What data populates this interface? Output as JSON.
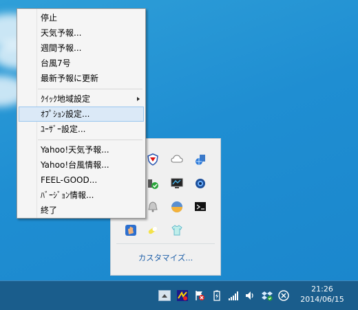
{
  "menu": {
    "items": [
      {
        "label": "停止"
      },
      {
        "label": "天気予報..."
      },
      {
        "label": "週間予報..."
      },
      {
        "label": "台風7号"
      },
      {
        "label": "最新予報に更新"
      },
      {
        "label": "ｸｲｯｸ地域設定"
      },
      {
        "label": "ｵﾌﾟｼｮﾝ設定..."
      },
      {
        "label": "ﾕｰｻﾞｰ設定..."
      },
      {
        "label": "Yahoo!天気予報..."
      },
      {
        "label": "Yahoo!台風情報..."
      },
      {
        "label": "FEEL-GOOD..."
      },
      {
        "label": "ﾊﾞｰｼﾞｮﾝ情報..."
      },
      {
        "label": "終了"
      }
    ]
  },
  "tray_flyout": {
    "customize_label": "カスタマイズ...",
    "icons": [
      "security-shield-icon",
      "cloud-icon",
      "network-globe-icon",
      "usb-device-icon",
      "monitor-icon",
      "webcam-icon",
      "bell-icon",
      "weather-sun-icon",
      "terminal-icon",
      "hand-app-icon",
      "pill-icon",
      "tshirt-icon"
    ]
  },
  "taskbar": {
    "time": "21:26",
    "date": "2014/06/15",
    "icons": [
      "show-hidden-icons-arrow",
      "app-tray-icon",
      "action-center-flag-icon",
      "power-battery-icon",
      "network-signal-icon",
      "volume-icon",
      "dropbox-icon",
      "close-circle-icon"
    ]
  },
  "colors": {
    "accent": "#1e5fa8",
    "taskbar": "#1a5d8c",
    "selection": "#dbe9f7"
  }
}
